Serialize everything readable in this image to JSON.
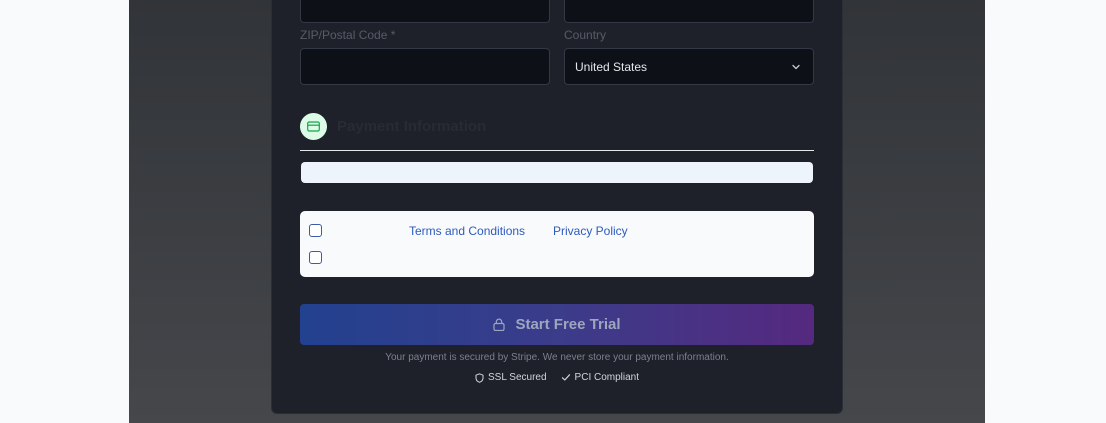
{
  "address": {
    "zip_label": "ZIP/Postal Code *",
    "zip_value": "",
    "country_label": "Country",
    "country_value": "United States"
  },
  "payment": {
    "section_title": "Payment Information",
    "icon": "credit-card-icon"
  },
  "terms": {
    "terms_link": "Terms and Conditions",
    "privacy_link": "Privacy Policy"
  },
  "cta": {
    "label": "Start Free Trial",
    "icon": "lock-icon"
  },
  "footer": {
    "secure_note": "Your payment is secured by Stripe. We never store your payment information.",
    "ssl_label": "SSL Secured",
    "pci_label": "PCI Compliant"
  },
  "colors": {
    "overlay": "#3a3d41",
    "card": "#1e2129",
    "accent": "#2e5bbd",
    "cta_start": "#22418f",
    "cta_end": "#55297f",
    "icon_bg": "#dcfce7",
    "icon_fg": "#16a34a"
  }
}
